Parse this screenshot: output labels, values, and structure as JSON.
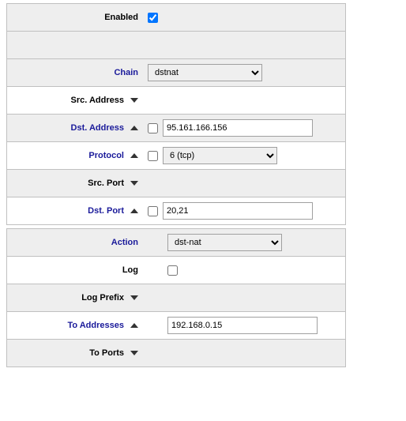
{
  "section1": {
    "enabled": {
      "label": "Enabled",
      "checked": true
    },
    "chain": {
      "label": "Chain",
      "value": "dstnat"
    },
    "src_address": {
      "label": "Src. Address"
    },
    "dst_address": {
      "label": "Dst. Address",
      "neg": false,
      "value": "95.161.166.156"
    },
    "protocol": {
      "label": "Protocol",
      "neg": false,
      "value": "6 (tcp)"
    },
    "src_port": {
      "label": "Src. Port"
    },
    "dst_port": {
      "label": "Dst. Port",
      "neg": false,
      "value": "20,21"
    }
  },
  "section2": {
    "action": {
      "label": "Action",
      "value": "dst-nat"
    },
    "log": {
      "label": "Log",
      "checked": false
    },
    "log_prefix": {
      "label": "Log Prefix"
    },
    "to_addresses": {
      "label": "To Addresses",
      "value": "192.168.0.15"
    },
    "to_ports": {
      "label": "To Ports"
    }
  }
}
